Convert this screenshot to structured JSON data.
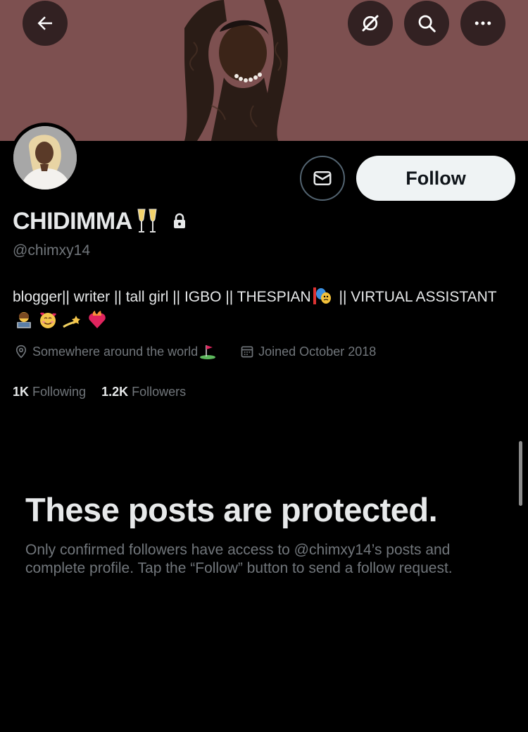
{
  "header": {
    "back_icon": "arrow-left-icon",
    "grok_icon": "grok-icon",
    "search_icon": "search-icon",
    "more_icon": "more-horizontal-icon"
  },
  "profile": {
    "display_name": "CHIDIMMA",
    "name_emoji": "clinking-glasses",
    "handle": "@chimxy14",
    "bio_text": "blogger|| writer || tall girl || IGBO || THESPIAN",
    "bio_text_2": " || VIRTUAL ASSISTANT",
    "bio_emojis": [
      "technologist",
      "smiling-face-with-hearts",
      "dizzy",
      "heart-on-fire"
    ],
    "location": "Somewhere around the world",
    "joined": "Joined October 2018",
    "following_count": "1K",
    "following_label": "Following",
    "followers_count": "1.2K",
    "followers_label": "Followers"
  },
  "actions": {
    "follow_label": "Follow",
    "message_icon": "envelope-icon"
  },
  "protected": {
    "title": "These posts are protected.",
    "description": "Only confirmed followers have access to @chimxy14’s posts and complete profile. Tap the “Follow” button to send a follow request."
  },
  "colors": {
    "background": "#000000",
    "banner": "#7d5050",
    "text_primary": "#e7e9ea",
    "text_secondary": "#71767b",
    "follow_button_bg": "#eff3f4"
  }
}
